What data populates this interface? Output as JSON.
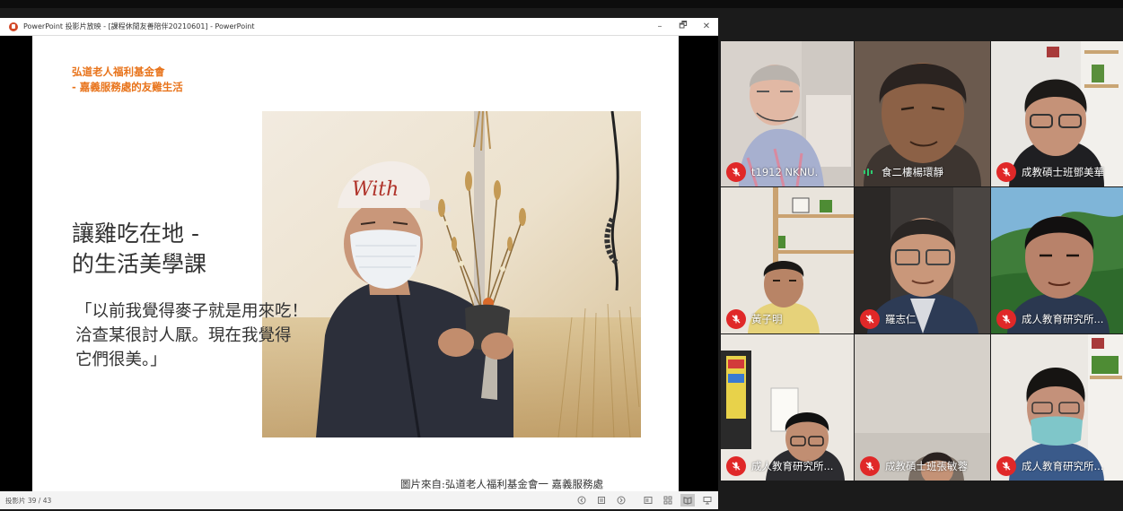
{
  "window": {
    "title": "PowerPoint 投影片放映 - [課程休閒友善陪伴20210601] - PowerPoint",
    "min_label": "–",
    "restore_label": "🗗",
    "close_label": "✕"
  },
  "slide": {
    "org_line1": "弘道老人福利基金會",
    "org_line2": " - 嘉義服務處的友雞生活",
    "heading_line1": "讓雞吃在地 -",
    "heading_line2": "的生活美學課",
    "quote_line1": "「以前我覺得麥子就是用來吃！",
    "quote_line2": "洽查某很討人厭。現在我覺得",
    "quote_line3": "它們很美。」",
    "photo_cap_text": "With",
    "credit": "圖片來自:弘道老人福利基金會一 嘉義服務處"
  },
  "statusbar": {
    "counter": "投影片 39 / 43",
    "icons": [
      "prev-icon",
      "menu-icon",
      "next-icon",
      "normal-view-icon",
      "sorter-view-icon",
      "reading-view-icon",
      "slideshow-icon"
    ]
  },
  "participants": [
    {
      "name": "t1912 NKNU.",
      "muted": true
    },
    {
      "name": "食二樓楊環靜",
      "muted": false
    },
    {
      "name": "成教碩士班鄧美華",
      "muted": true
    },
    {
      "name": "黃子明",
      "muted": true
    },
    {
      "name": "羅志仁",
      "muted": true
    },
    {
      "name": "成人教育研究所...",
      "muted": true
    },
    {
      "name": "成人教育研究所...",
      "muted": true
    },
    {
      "name": "成教碩士班張敏蓉",
      "muted": true
    },
    {
      "name": "成人教育研究所...",
      "muted": true
    }
  ],
  "colors": {
    "accent_orange": "#e8731a",
    "mute_red": "#e02828",
    "ppt_red": "#d24726"
  }
}
